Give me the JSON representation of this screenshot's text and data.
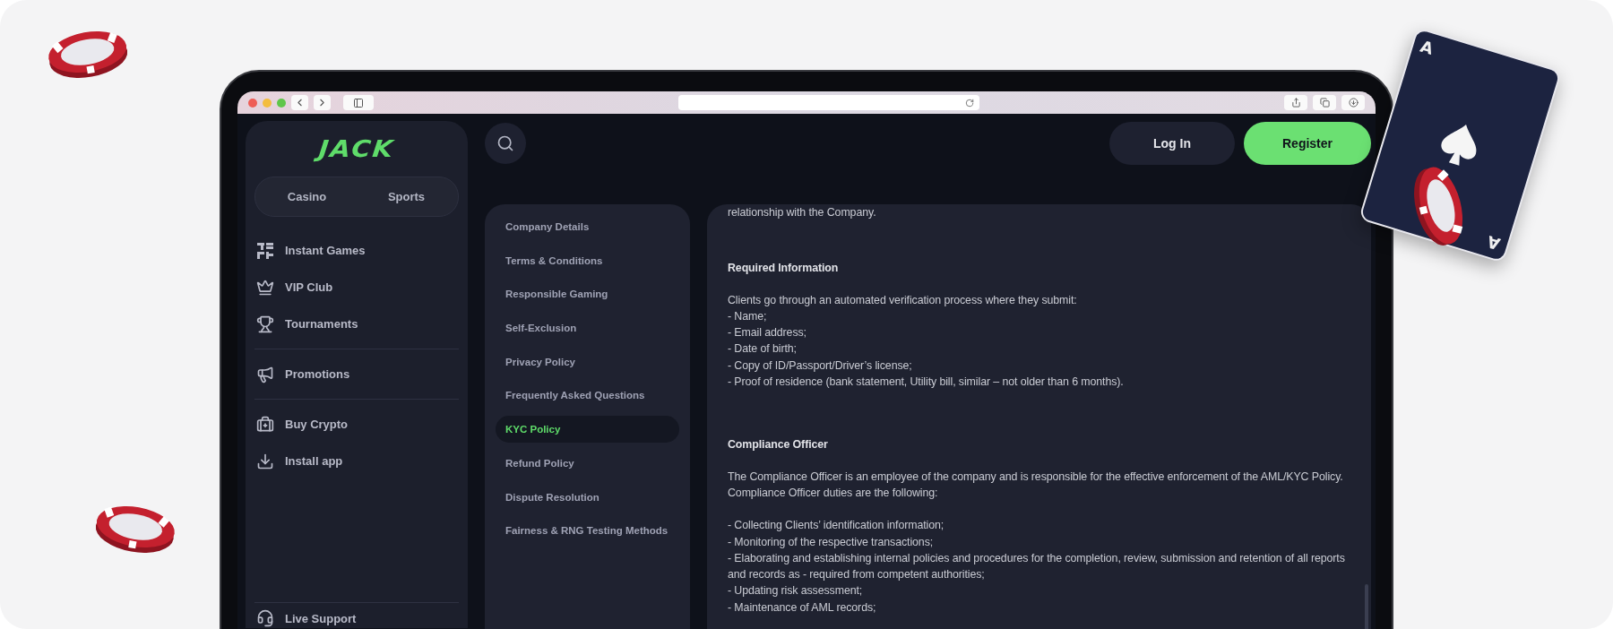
{
  "card": {
    "corners": [
      "A",
      "A"
    ]
  },
  "brand": {
    "logo": "JACK"
  },
  "sidebar": {
    "tabs": [
      {
        "label": "Casino",
        "selected": false
      },
      {
        "label": "Sports",
        "selected": false
      }
    ],
    "groups": [
      [
        {
          "label": "Instant Games"
        },
        {
          "label": "VIP Club"
        },
        {
          "label": "Tournaments"
        }
      ],
      [
        {
          "label": "Promotions"
        }
      ],
      [
        {
          "label": "Buy Crypto"
        },
        {
          "label": "Install app"
        }
      ]
    ],
    "footer": {
      "label": "Live Support"
    }
  },
  "header": {
    "buttons": [
      {
        "label": "Log In",
        "kind": "secondary"
      },
      {
        "label": "Register",
        "kind": "primary"
      }
    ]
  },
  "policy_menu": {
    "items": [
      {
        "label": "Company Details",
        "selected": false
      },
      {
        "label": "Terms & Conditions",
        "selected": false
      },
      {
        "label": "Responsible Gaming",
        "selected": false
      },
      {
        "label": "Self-Exclusion",
        "selected": false
      },
      {
        "label": "Privacy Policy",
        "selected": false
      },
      {
        "label": "Frequently Asked Questions",
        "selected": false
      },
      {
        "label": "KYC Policy",
        "selected": true
      },
      {
        "label": "Refund Policy",
        "selected": false
      },
      {
        "label": "Dispute Resolution",
        "selected": false
      },
      {
        "label": "Fairness & RNG Testing Methods",
        "selected": false
      }
    ]
  },
  "document": {
    "lead": "relationship with the Company.",
    "sections": [
      {
        "heading": "Required Information",
        "paragraphs": [
          [
            "Clients go through an automated verification process where they submit:",
            "- Name;",
            "- Email address;",
            "- Date of birth;",
            "- Copy of ID/Passport/Driver’s license;",
            "- Proof of residence (bank statement, Utility bill, similar – not older than 6 months)."
          ]
        ]
      },
      {
        "heading": "Compliance Officer",
        "paragraphs": [
          [
            "The Compliance Officer is an employee of the company and is responsible for the effective enforcement of the AML/KYC Policy.",
            "Compliance Officer duties are the following:"
          ],
          [
            "- Collecting Clients’ identification information;",
            "- Monitoring of the respective transactions;",
            "- Elaborating and establishing internal policies and procedures for the completion, review, submission and retention of all reports and records as - required from competent authorities;",
            "- Updating risk assessment;",
            "- Maintenance of AML records;"
          ]
        ]
      }
    ]
  }
}
